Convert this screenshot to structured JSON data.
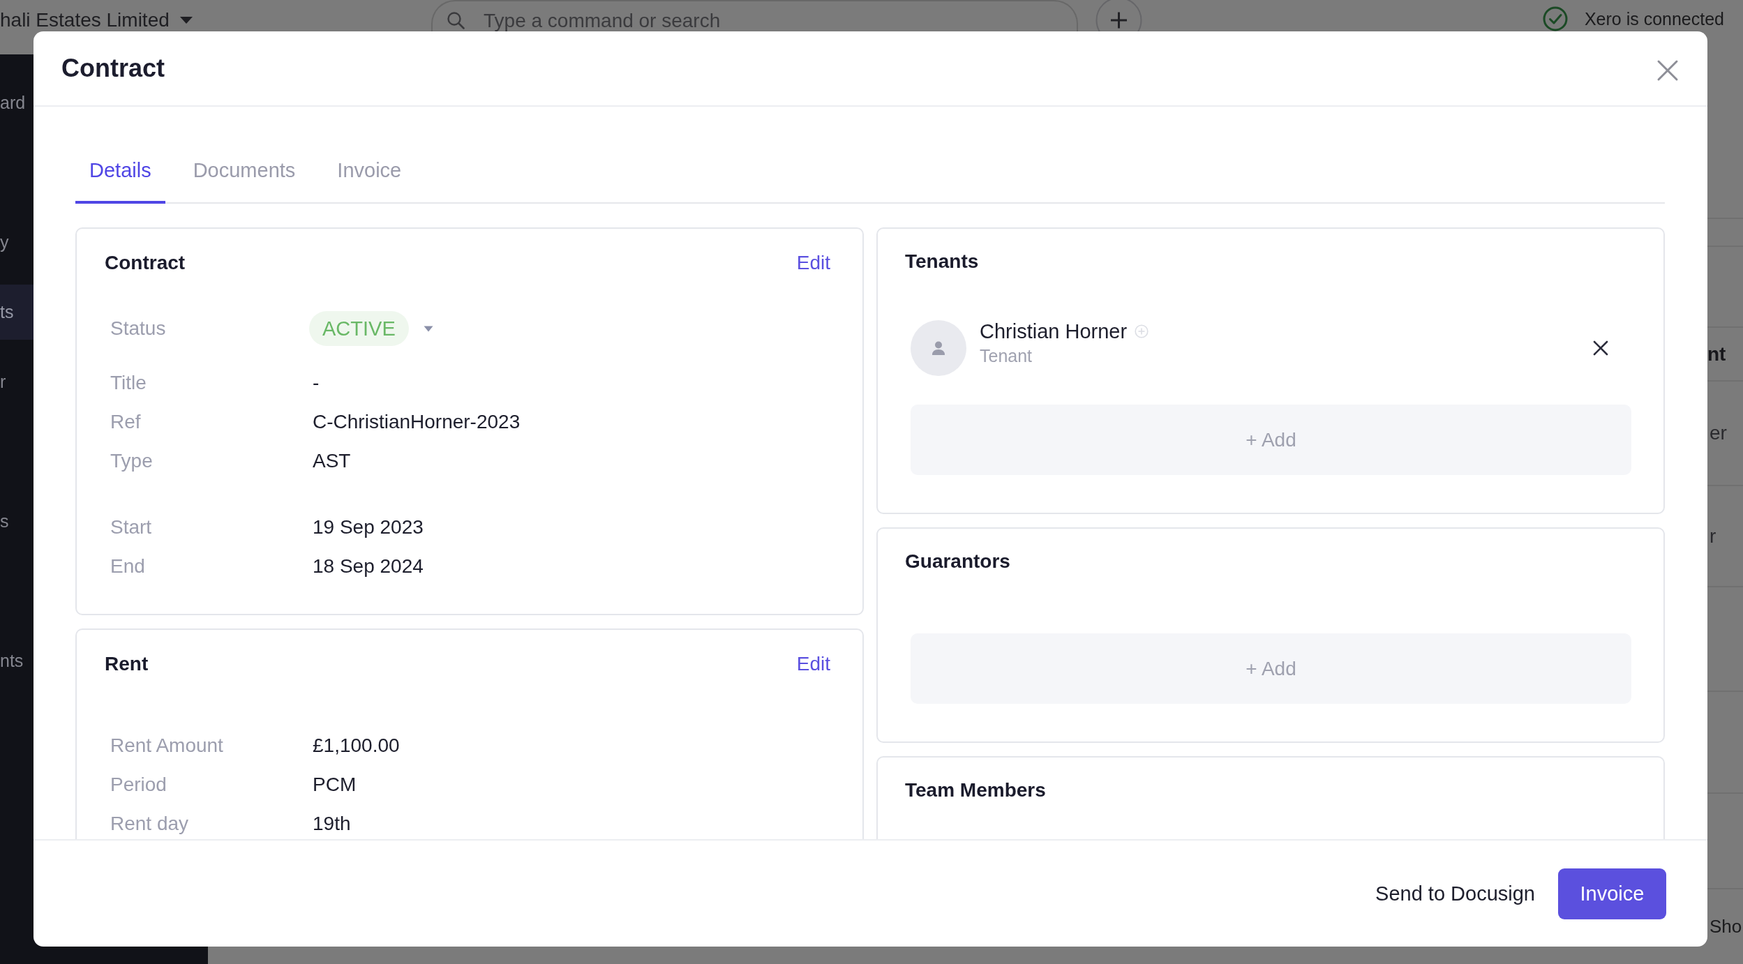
{
  "app": {
    "org_name": "hali Estates Limited",
    "search": {
      "placeholder": "Type a command or search"
    },
    "connection_status": "Xero is connected",
    "sidebar": {
      "items": [
        {
          "label": "ard",
          "selected": false
        },
        {
          "label": "y",
          "selected": false
        },
        {
          "label": "ts",
          "selected": true
        },
        {
          "label": "r",
          "selected": false
        },
        {
          "label": "s",
          "selected": false
        },
        {
          "label": "nts",
          "selected": false
        }
      ]
    },
    "table": {
      "columns": [
        {
          "label": "nt"
        }
      ],
      "rows": [
        [
          "er"
        ],
        [
          "r"
        ]
      ],
      "footer_text": "Sho"
    }
  },
  "modal": {
    "title": "Contract",
    "tabs": [
      {
        "label": "Details",
        "selected": true
      },
      {
        "label": "Documents",
        "selected": false
      },
      {
        "label": "Invoice",
        "selected": false
      }
    ],
    "left_cards": [
      {
        "title": "Contract",
        "action": "Edit",
        "groups": [
          {
            "fields": [
              {
                "kind": "status",
                "label": "Status",
                "value": "ACTIVE"
              },
              {
                "kind": "text",
                "label": "Title",
                "value": "-"
              },
              {
                "kind": "text",
                "label": "Ref",
                "value": "C-ChristianHorner-2023"
              },
              {
                "kind": "text",
                "label": "Type",
                "value": "AST"
              }
            ]
          },
          {
            "fields": [
              {
                "kind": "text",
                "label": "Start",
                "value": "19 Sep 2023"
              },
              {
                "kind": "text",
                "label": "End",
                "value": "18 Sep 2024"
              }
            ]
          }
        ]
      },
      {
        "title": "Rent",
        "action": "Edit",
        "groups": [
          {
            "fields": [
              {
                "kind": "text",
                "label": "Rent Amount",
                "value": "£1,100.00"
              },
              {
                "kind": "text",
                "label": "Period",
                "value": "PCM"
              },
              {
                "kind": "text",
                "label": "Rent day",
                "value": "19th"
              }
            ]
          }
        ]
      }
    ],
    "right_cards": [
      {
        "title": "Tenants",
        "people": [
          {
            "name": "Christian Horner",
            "role": "Tenant"
          }
        ],
        "add_label": "+ Add"
      },
      {
        "title": "Guarantors",
        "add_label": "+ Add"
      },
      {
        "title": "Team Members"
      }
    ],
    "footer": {
      "secondary_button": "Send to Docusign",
      "primary_button": "Invoice"
    }
  }
}
